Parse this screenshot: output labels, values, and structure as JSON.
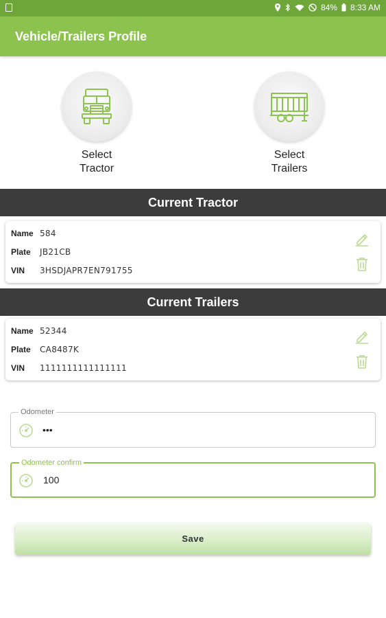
{
  "status_bar": {
    "battery": "84%",
    "time": "8:33 AM"
  },
  "app_bar": {
    "title": "Vehicle/Trailers Profile"
  },
  "select_tractor": {
    "label": "Select Tractor",
    "icon": "truck-icon"
  },
  "select_trailers": {
    "label": "Select Trailers",
    "icon": "trailer-icon"
  },
  "current_tractor": {
    "header": "Current Tractor",
    "fields": [
      {
        "key": "Name",
        "value": "584"
      },
      {
        "key": "Plate",
        "value": "JB21CB"
      },
      {
        "key": "VIN",
        "value": "3HSDJAPR7EN791755"
      }
    ]
  },
  "current_trailers": {
    "header": "Current Trailers",
    "fields": [
      {
        "key": "Name",
        "value": "52344"
      },
      {
        "key": "Plate",
        "value": "CA8487K"
      },
      {
        "key": "VIN",
        "value": "1111111111111111"
      }
    ]
  },
  "odometer": {
    "label": "Odometer",
    "value": "•••"
  },
  "odometer_confirm": {
    "label": "Odometer confirm",
    "value": "100"
  },
  "save": {
    "label": "Save"
  },
  "colors": {
    "primary": "#8cc34f",
    "status_bar": "#6fa63a",
    "header_dark": "#3c3c3c"
  }
}
